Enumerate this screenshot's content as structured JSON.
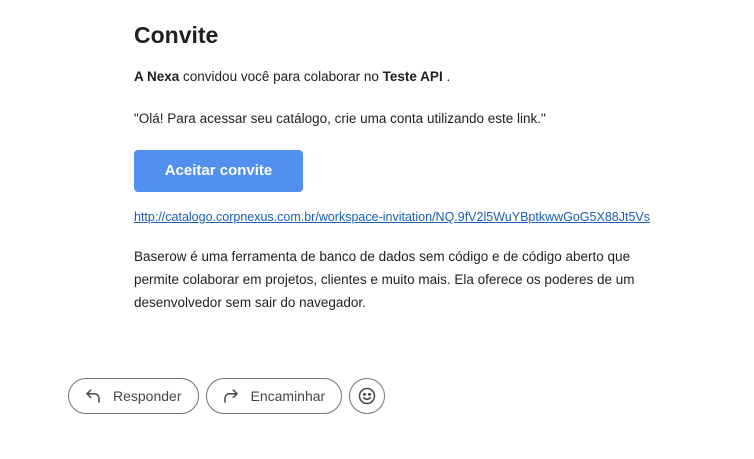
{
  "email": {
    "title": "Convite",
    "intro": {
      "inviter": "A Nexa",
      "middle": " convidou você para colaborar no ",
      "workspace": "Teste API",
      "end": " ."
    },
    "quote": "\"Olá! Para acessar seu catálogo, crie uma conta utilizando este link.\"",
    "accept_button_label": "Aceitar convite",
    "accept_button_color": "#5190ef",
    "invite_link": "http://catalogo.corpnexus.com.br/workspace-invitation/NQ.9fV2l5WuYBptkwwGoG5X88Jt5Vs",
    "description": "Baserow é uma ferramenta de banco de dados sem código e de código aberto que permite colaborar em projetos, clientes e muito mais. Ela oferece os poderes de um desenvolvedor sem sair do navegador."
  },
  "actions": {
    "reply": {
      "label": "Responder",
      "icon": "reply-icon"
    },
    "forward": {
      "label": "Encaminhar",
      "icon": "forward-icon"
    },
    "emoji": {
      "icon": "emoji-icon"
    }
  }
}
